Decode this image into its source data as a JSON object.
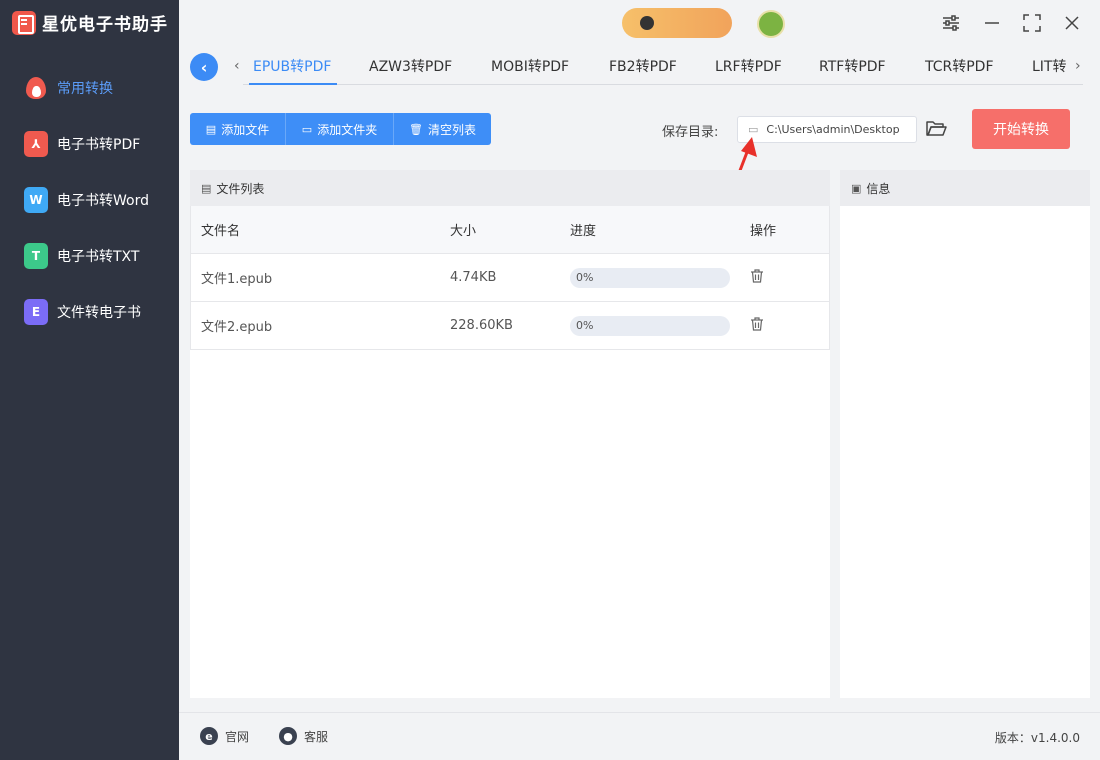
{
  "app": {
    "title": "星优电子书助手"
  },
  "sidebar": {
    "items": [
      {
        "label": "常用转换",
        "icon": "flame-icon",
        "color": "#f05a4f"
      },
      {
        "label": "电子书转PDF",
        "icon": "pdf-icon",
        "color": "#f05a4f",
        "glyph": "⅄"
      },
      {
        "label": "电子书转Word",
        "icon": "word-icon",
        "color": "#3fa9f5",
        "glyph": "W"
      },
      {
        "label": "电子书转TXT",
        "icon": "txt-icon",
        "color": "#3cc98a",
        "glyph": "T"
      },
      {
        "label": "文件转电子书",
        "icon": "ebook-icon",
        "color": "#7b6cf6",
        "glyph": "E"
      }
    ]
  },
  "tabs": [
    {
      "label": "EPUB转PDF"
    },
    {
      "label": "AZW3转PDF"
    },
    {
      "label": "MOBI转PDF"
    },
    {
      "label": "FB2转PDF"
    },
    {
      "label": "LRF转PDF"
    },
    {
      "label": "RTF转PDF"
    },
    {
      "label": "TCR转PDF"
    },
    {
      "label": "LIT转"
    }
  ],
  "toolbar": {
    "add_file": "添加文件",
    "add_folder": "添加文件夹",
    "clear_list": "清空列表",
    "save_label": "保存目录:",
    "save_path": "C:\\Users\\admin\\Desktop",
    "start": "开始转换"
  },
  "file_panel": {
    "title": "文件列表",
    "columns": [
      "文件名",
      "大小",
      "进度",
      "操作"
    ],
    "rows": [
      {
        "name": "文件1.epub",
        "size": "4.74KB",
        "progress": "0%"
      },
      {
        "name": "文件2.epub",
        "size": "228.60KB",
        "progress": "0%"
      }
    ]
  },
  "info_panel": {
    "title": "信息"
  },
  "footer": {
    "website": "官网",
    "support": "客服",
    "version": "版本：v1.4.0.0"
  },
  "colors": {
    "accent": "#3e8ef7",
    "start": "#f66f6a",
    "sidebar": "#2f3441",
    "arrow": "#e8302a"
  }
}
